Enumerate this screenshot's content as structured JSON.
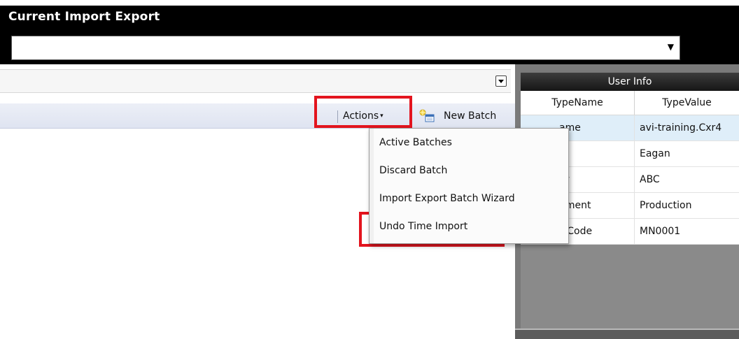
{
  "window": {
    "title": "Current Import Export"
  },
  "selector": {
    "value": ""
  },
  "toolbar": {
    "actions_label": "Actions",
    "new_batch_label": "New Batch"
  },
  "actions_menu": {
    "items": [
      {
        "label": "Active Batches"
      },
      {
        "label": "Discard Batch"
      },
      {
        "label": "Import Export Batch Wizard"
      },
      {
        "label": "Undo Time Import"
      }
    ]
  },
  "user_info": {
    "title": "User Info",
    "columns": [
      "TypeName",
      "TypeValue"
    ],
    "rows": [
      {
        "name": "ame",
        "value": "avi-training.Cxr4"
      },
      {
        "name": "",
        "value": "Eagan"
      },
      {
        "name": "er",
        "value": "ABC"
      },
      {
        "name": "nment",
        "value": "Production"
      },
      {
        "name": "rtCode",
        "value": "MN0001"
      }
    ]
  },
  "colors": {
    "highlight": "#e3141e",
    "header_bg": "#000000",
    "selected_row": "#dfeef9"
  },
  "icons": [
    "chevron-down-icon",
    "new-batch-icon",
    "dropdown-caret-icon"
  ]
}
